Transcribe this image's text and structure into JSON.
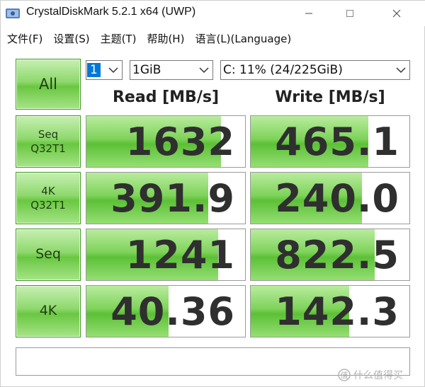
{
  "window": {
    "title": "CrystalDiskMark 5.2.1 x64 (UWP)",
    "controls": {
      "minimize": "—",
      "maximize": "☐",
      "close": "✕"
    }
  },
  "menu": {
    "items": [
      "文件(F)",
      "设置(S)",
      "主题(T)",
      "帮助(H)",
      "语言(L)(Language)"
    ]
  },
  "controls": {
    "all_label": "All",
    "test_count": "1",
    "test_size": "1GiB",
    "drive": "C: 11% (24/225GiB)"
  },
  "columns": {
    "read": "Read [MB/s]",
    "write": "Write [MB/s]"
  },
  "rows": [
    {
      "label_line1": "Seq",
      "label_line2": "Q32T1",
      "read": "1632",
      "write": "465.1",
      "read_fill": 0.85,
      "write_fill": 0.74
    },
    {
      "label_line1": "4K",
      "label_line2": "Q32T1",
      "read": "391.9",
      "write": "240.0",
      "read_fill": 0.77,
      "write_fill": 0.7
    },
    {
      "label_line1": "Seq",
      "label_line2": "",
      "read": "1241",
      "write": "822.5",
      "read_fill": 0.83,
      "write_fill": 0.78
    },
    {
      "label_line1": "4K",
      "label_line2": "",
      "read": "40.36",
      "write": "142.3",
      "read_fill": 0.52,
      "write_fill": 0.62
    }
  ],
  "comment": "",
  "watermark": {
    "text": "什么值得买"
  },
  "colors": {
    "accent_green": "#6ac742",
    "select_highlight": "#0078d7"
  }
}
